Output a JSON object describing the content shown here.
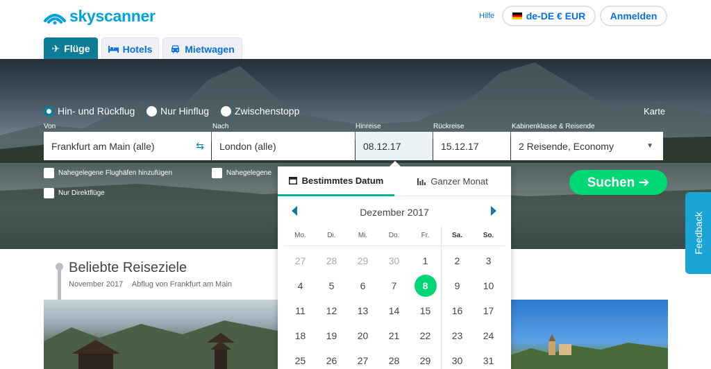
{
  "header": {
    "logo_text": "skyscanner",
    "help_label": "Hilfe",
    "locale_label": "de-DE € EUR",
    "login_label": "Anmelden"
  },
  "tabs": [
    {
      "label": "Flüge",
      "icon": "plane-icon",
      "active": true
    },
    {
      "label": "Hotels",
      "icon": "bed-icon",
      "active": false
    },
    {
      "label": "Mietwagen",
      "icon": "car-icon",
      "active": false
    }
  ],
  "trip_type": {
    "options": [
      "Hin- und Rückflug",
      "Nur Hinflug",
      "Zwischenstopp"
    ],
    "selected": "Hin- und Rückflug"
  },
  "map_label": "Karte",
  "fields": {
    "from": {
      "label": "Von",
      "value": "Frankfurt am Main (alle)"
    },
    "to": {
      "label": "Nach",
      "value": "London (alle)"
    },
    "depart": {
      "label": "Hinreise",
      "value": "08.12.17"
    },
    "return": {
      "label": "Rückreise",
      "value": "15.12.17"
    },
    "cabin": {
      "label": "Kabinenklasse & Reisende",
      "value": "2 Reisende, Economy"
    }
  },
  "checkboxes": {
    "nearby_from": "Nahegelegene Flughäfen hinzufügen",
    "nearby_to": "Nahegelegene",
    "direct": "Nur Direktflüge"
  },
  "search_label": "Suchen ➔",
  "feedback_label": "Feedback",
  "popular": {
    "title": "Beliebte Reiseziele",
    "month": "November 2017",
    "origin": "Abflug von Frankfurt am Main"
  },
  "calendar": {
    "tab_specific": "Bestimmtes Datum",
    "tab_month": "Ganzer Monat",
    "month_label": "Dezember 2017",
    "weekdays": [
      "Mo.",
      "Di.",
      "Mi.",
      "Do.",
      "Fr.",
      "Sa.",
      "So."
    ],
    "weeks": [
      [
        "27",
        "28",
        "29",
        "30",
        "1",
        "2",
        "3"
      ],
      [
        "4",
        "5",
        "6",
        "7",
        "8",
        "9",
        "10"
      ],
      [
        "11",
        "12",
        "13",
        "14",
        "15",
        "16",
        "17"
      ],
      [
        "18",
        "19",
        "20",
        "21",
        "22",
        "23",
        "24"
      ],
      [
        "25",
        "26",
        "27",
        "28",
        "29",
        "30",
        "31"
      ]
    ],
    "selected_day": "8",
    "colors": {
      "accent": "#0e7c97",
      "selected": "#00d775",
      "tab_underline": "#00b59b"
    }
  }
}
